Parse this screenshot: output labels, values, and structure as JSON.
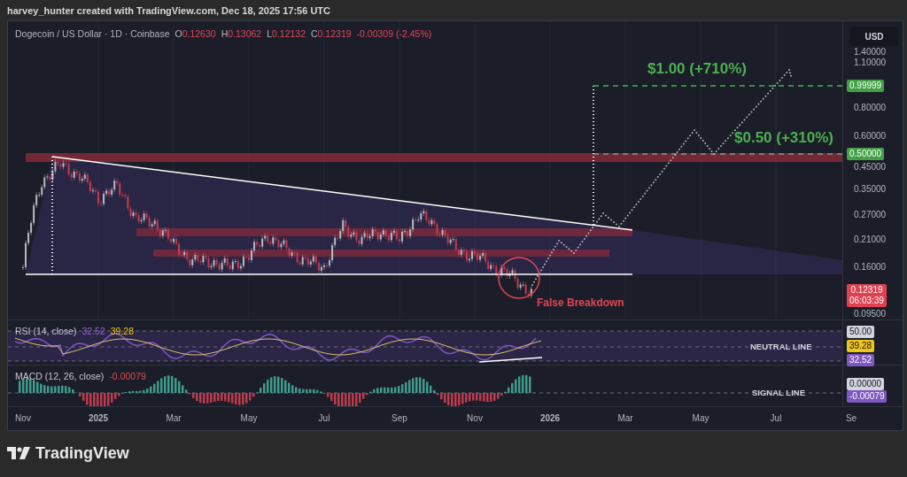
{
  "header": {
    "text": "harvey_hunter created with TradingView.com, Dec 18, 2025 17:56 UTC"
  },
  "legend": {
    "symbol": "Dogecoin / US Dollar · 1D · Coinbase",
    "ohlc": [
      {
        "label": "O",
        "value": "0.12630"
      },
      {
        "label": "H",
        "value": "0.13062"
      },
      {
        "label": "L",
        "value": "0.12132"
      },
      {
        "label": "C",
        "value": "0.12319"
      }
    ],
    "change": "-0.00309 (-2.45%)"
  },
  "currency_button": "USD",
  "main_chart": {
    "annotations": [
      {
        "kind": "target",
        "text": "$1.00 (+710%)"
      },
      {
        "kind": "target",
        "text": "$0.50 (+310%)"
      },
      {
        "kind": "note",
        "text": "False Breakdown"
      }
    ],
    "price_axis": [
      "1.40000",
      "1.10000",
      "0.80000",
      "0.60000",
      "0.45000",
      "0.35000",
      "0.27000",
      "0.21000",
      "0.16000",
      "0.09500"
    ],
    "price_badges": [
      {
        "kind": "target",
        "text": "0.99999"
      },
      {
        "kind": "target",
        "text": "0.50000"
      },
      {
        "kind": "last",
        "text": "0.12319",
        "countdown": "06:03:39"
      }
    ]
  },
  "rsi": {
    "title": "RSI (14, close)",
    "value": "32.52",
    "signal": "39.28",
    "line_label": "NEUTRAL LINE",
    "badges": [
      {
        "kind": "level",
        "text": "50.00"
      },
      {
        "kind": "signal",
        "text": "39.28"
      },
      {
        "kind": "value",
        "text": "32.52"
      }
    ]
  },
  "macd": {
    "title": "MACD (12, 26, close)",
    "value": "-0.00079",
    "line_label": "SIGNAL LINE",
    "badges": [
      {
        "kind": "zero",
        "text": "0.00000"
      },
      {
        "kind": "value",
        "text": "-0.00079"
      }
    ]
  },
  "time_axis": [
    {
      "label": "Nov",
      "major": false
    },
    {
      "label": "2025",
      "major": true
    },
    {
      "label": "Mar",
      "major": false
    },
    {
      "label": "May",
      "major": false
    },
    {
      "label": "Jul",
      "major": false
    },
    {
      "label": "Sep",
      "major": false
    },
    {
      "label": "Nov",
      "major": false
    },
    {
      "label": "2026",
      "major": true
    },
    {
      "label": "Mar",
      "major": false
    },
    {
      "label": "May",
      "major": false
    },
    {
      "label": "Jul",
      "major": false
    },
    {
      "label": "Se",
      "major": false
    }
  ],
  "footer": {
    "brand": "TradingView"
  }
}
